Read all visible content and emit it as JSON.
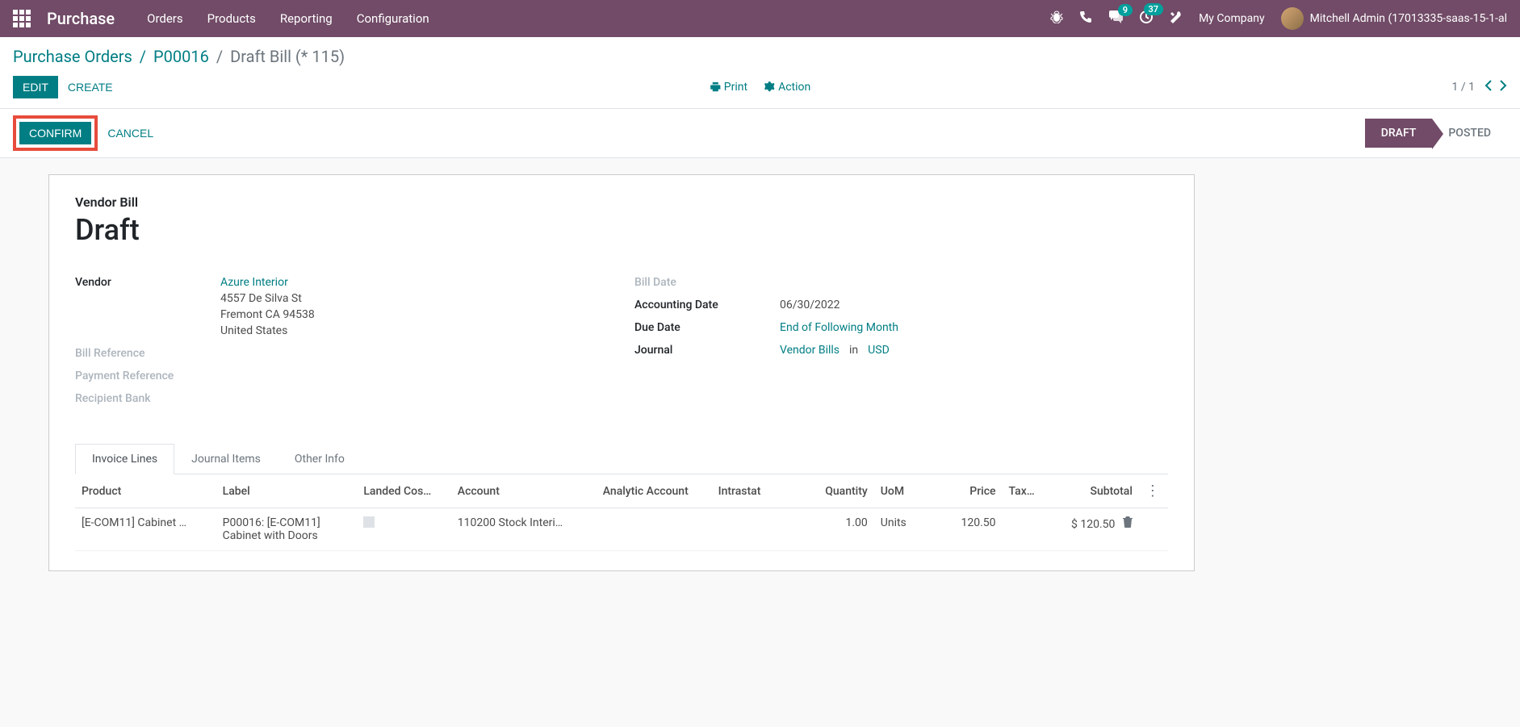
{
  "navbar": {
    "brand": "Purchase",
    "menu": [
      "Orders",
      "Products",
      "Reporting",
      "Configuration"
    ],
    "chat_badge": "9",
    "activity_badge": "37",
    "company": "My Company",
    "user": "Mitchell Admin (17013335-saas-15-1-al"
  },
  "breadcrumb": {
    "parent1": "Purchase Orders",
    "parent2": "P00016",
    "current": "Draft Bill (* 115)"
  },
  "toolbar": {
    "edit": "EDIT",
    "create": "CREATE",
    "print": "Print",
    "action": "Action",
    "pager": "1 / 1"
  },
  "statusbar": {
    "confirm": "CONFIRM",
    "cancel": "CANCEL",
    "draft": "DRAFT",
    "posted": "POSTED"
  },
  "form": {
    "subtitle": "Vendor Bill",
    "title": "Draft",
    "left": {
      "vendor_label": "Vendor",
      "vendor_name": "Azure Interior",
      "vendor_addr1": "4557 De Silva St",
      "vendor_addr2": "Fremont CA 94538",
      "vendor_addr3": "United States",
      "bill_ref_label": "Bill Reference",
      "payment_ref_label": "Payment Reference",
      "recipient_bank_label": "Recipient Bank"
    },
    "right": {
      "bill_date_label": "Bill Date",
      "accounting_date_label": "Accounting Date",
      "accounting_date": "06/30/2022",
      "due_date_label": "Due Date",
      "due_date": "End of Following Month",
      "journal_label": "Journal",
      "journal": "Vendor Bills",
      "journal_in": "in",
      "journal_currency": "USD"
    }
  },
  "tabs": {
    "invoice_lines": "Invoice Lines",
    "journal_items": "Journal Items",
    "other_info": "Other Info"
  },
  "table": {
    "headers": {
      "product": "Product",
      "label": "Label",
      "landed": "Landed Cos…",
      "account": "Account",
      "analytic": "Analytic Account",
      "intrastat": "Intrastat",
      "quantity": "Quantity",
      "uom": "UoM",
      "price": "Price",
      "tax": "Tax…",
      "subtotal": "Subtotal"
    },
    "row": {
      "product": "[E-COM11] Cabinet …",
      "label": "P00016: [E-COM11] Cabinet with Doors",
      "account": "110200 Stock Interi…",
      "quantity": "1.00",
      "uom": "Units",
      "price": "120.50",
      "subtotal": "$ 120.50"
    }
  }
}
